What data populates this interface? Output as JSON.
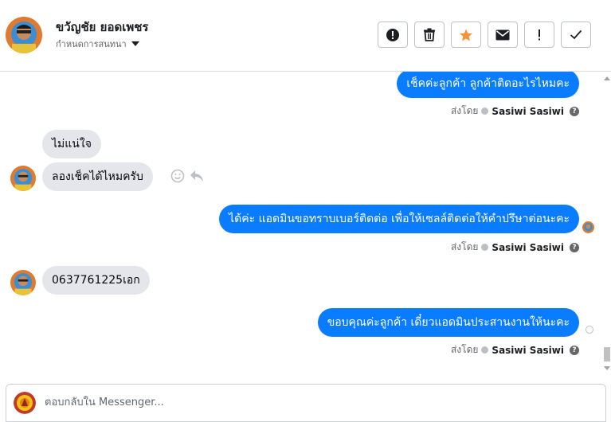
{
  "header": {
    "contact_name": "ขวัญชัย ยอดเพชร",
    "assign_label": "กำหนดการสนทนา",
    "actions": [
      {
        "name": "spam-button",
        "icon": "exclamation-circle-icon"
      },
      {
        "name": "delete-button",
        "icon": "trash-icon"
      },
      {
        "name": "star-button",
        "icon": "star-icon",
        "color": "#f7923b"
      },
      {
        "name": "mark-unread-button",
        "icon": "envelope-icon"
      },
      {
        "name": "follow-up-button",
        "icon": "exclamation-icon"
      },
      {
        "name": "done-button",
        "icon": "checkmark-icon"
      }
    ]
  },
  "thread": {
    "messages": [
      {
        "direction": "outgoing",
        "text": "เช็คค่ะลูกค้า ลูกค้าติดอะไรไหมคะ"
      },
      {
        "direction": "incoming",
        "text": "ไม่แน่ใจ"
      },
      {
        "direction": "incoming",
        "text": "ลองเช็คได้ไหมครับ"
      },
      {
        "direction": "outgoing",
        "text": "ได้ค่ะ แอดมินขอทราบเบอร์ติดต่อ เพื่อให้เซลล์ติดต่อให้คำปรึษาต่อนะคะ"
      },
      {
        "direction": "incoming",
        "text": "0637761225เอก"
      },
      {
        "direction": "outgoing",
        "text": "ขอบคุณค่ะลูกค้า เดี๋ยวแอดมินประสานงานให้นะคะ"
      }
    ],
    "sent_by_prefix": "ส่งโดย",
    "sender_name": "Sasiwi Sasiwi",
    "help_glyph": "?"
  },
  "composer": {
    "placeholder": "ตอบกลับใน Messenger..."
  },
  "colors": {
    "outgoing_bubble": "#0a7cff",
    "incoming_bubble": "#e4e6eb",
    "star": "#f7923b"
  }
}
